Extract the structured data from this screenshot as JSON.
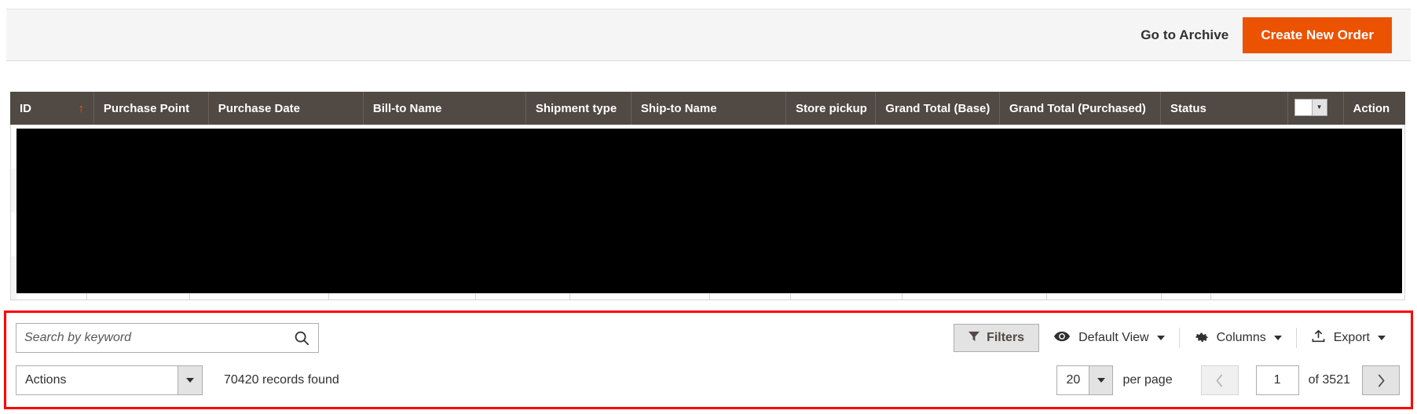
{
  "page_actions": {
    "archive_label": "Go to Archive",
    "create_label": "Create New Order",
    "primary_color": "#eb5202"
  },
  "grid": {
    "columns": [
      {
        "label": "ID",
        "sorted": true,
        "sort_arrow": "↑",
        "width": "5.4%"
      },
      {
        "label": "Purchase Point",
        "width": "7.4%"
      },
      {
        "label": "Purchase Date",
        "width": "10.0%"
      },
      {
        "label": "Bill-to Name",
        "width": "10.5%"
      },
      {
        "label": "Shipment type",
        "width": "6.8%"
      },
      {
        "label": "Ship-to Name",
        "width": "10.0%"
      },
      {
        "label": "Store pickup",
        "width": "5.8%"
      },
      {
        "label": "Grand Total (Base)",
        "width": "8.0%"
      },
      {
        "label": "Grand Total (Purchased)",
        "width": "10.4%"
      },
      {
        "label": "Status",
        "width": "8.2%"
      },
      {
        "label": "",
        "is_massaction": true,
        "width": "3.6%"
      },
      {
        "label": "Action",
        "width": "4.0%"
      }
    ],
    "header_bg": "#514943",
    "sort_arrow_color": "#ff5501",
    "body_masked": true
  },
  "toolbar": {
    "highlight_color": "#ff0000",
    "search": {
      "value": "",
      "placeholder": "Search by keyword",
      "icon": "search-icon"
    },
    "filters_label": "Filters",
    "filters_icon": "funnel-icon",
    "view_label": "Default View",
    "view_icon": "eye-icon",
    "columns_label": "Columns",
    "columns_icon": "gear-icon",
    "export_label": "Export",
    "export_icon": "upload-icon",
    "actions_select": {
      "value": "Actions"
    },
    "records_found": "70420 records found",
    "pagination": {
      "per_page_value": "20",
      "per_page_label": "per page",
      "prev_icon": "chevron-left-icon",
      "next_icon": "chevron-right-icon",
      "current_page": "1",
      "total_pages_label": "of 3521"
    }
  }
}
